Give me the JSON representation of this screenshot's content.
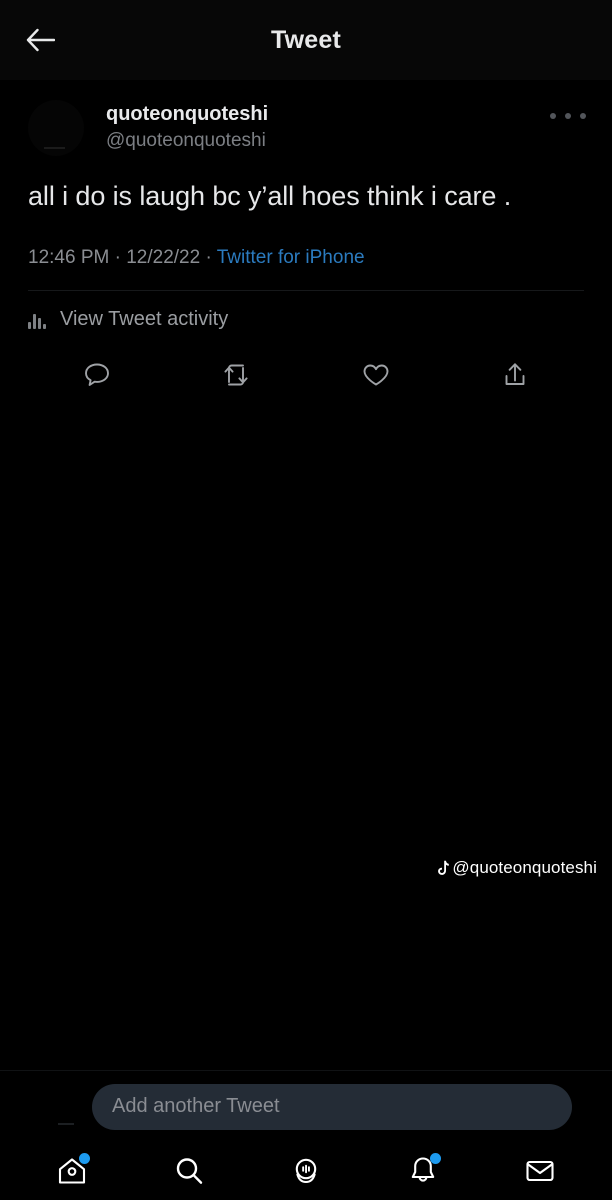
{
  "header": {
    "title": "Tweet",
    "back_icon": "arrow-left-icon",
    "more_icon": "more-horizontal-icon"
  },
  "tweet": {
    "display_name": "quoteonquoteshi",
    "handle": "@quoteonquoteshi",
    "text": "all i do is laugh bc y’all hoes think i care .",
    "time": "12:46 PM",
    "separator_1": " · ",
    "date": "12/22/22",
    "separator_2": " · ",
    "source": "Twitter for iPhone",
    "source_color": "#2b7bbf",
    "activity_label": "View Tweet activity",
    "activity_icon": "bar-chart-icon",
    "actions": [
      {
        "name": "reply-icon",
        "label": "Reply"
      },
      {
        "name": "retweet-icon",
        "label": "Retweet"
      },
      {
        "name": "like-icon",
        "label": "Like"
      },
      {
        "name": "share-icon",
        "label": "Share"
      }
    ]
  },
  "watermark": {
    "icon": "tiktok-note-icon",
    "handle": "@quoteonquoteshi"
  },
  "compose": {
    "placeholder": "Add another Tweet",
    "value": ""
  },
  "bottom_nav": {
    "badge_color": "#1d9bf0",
    "items": [
      {
        "name": "nav-home",
        "icon": "home-icon",
        "label": "Home",
        "badge": true
      },
      {
        "name": "nav-search",
        "icon": "search-icon",
        "label": "Search",
        "badge": false
      },
      {
        "name": "nav-spaces",
        "icon": "spaces-mic-icon",
        "label": "Spaces",
        "badge": false
      },
      {
        "name": "nav-notifications",
        "icon": "bell-icon",
        "label": "Notifications",
        "badge": true
      },
      {
        "name": "nav-messages",
        "icon": "envelope-icon",
        "label": "Messages",
        "badge": false
      }
    ]
  },
  "theme": {
    "background": "#000000",
    "header_background": "#070707",
    "primary_text": "#e8e9ea",
    "secondary_text": "#8b8e93",
    "accent": "#1d9bf0",
    "compose_pill": "#242c36"
  }
}
